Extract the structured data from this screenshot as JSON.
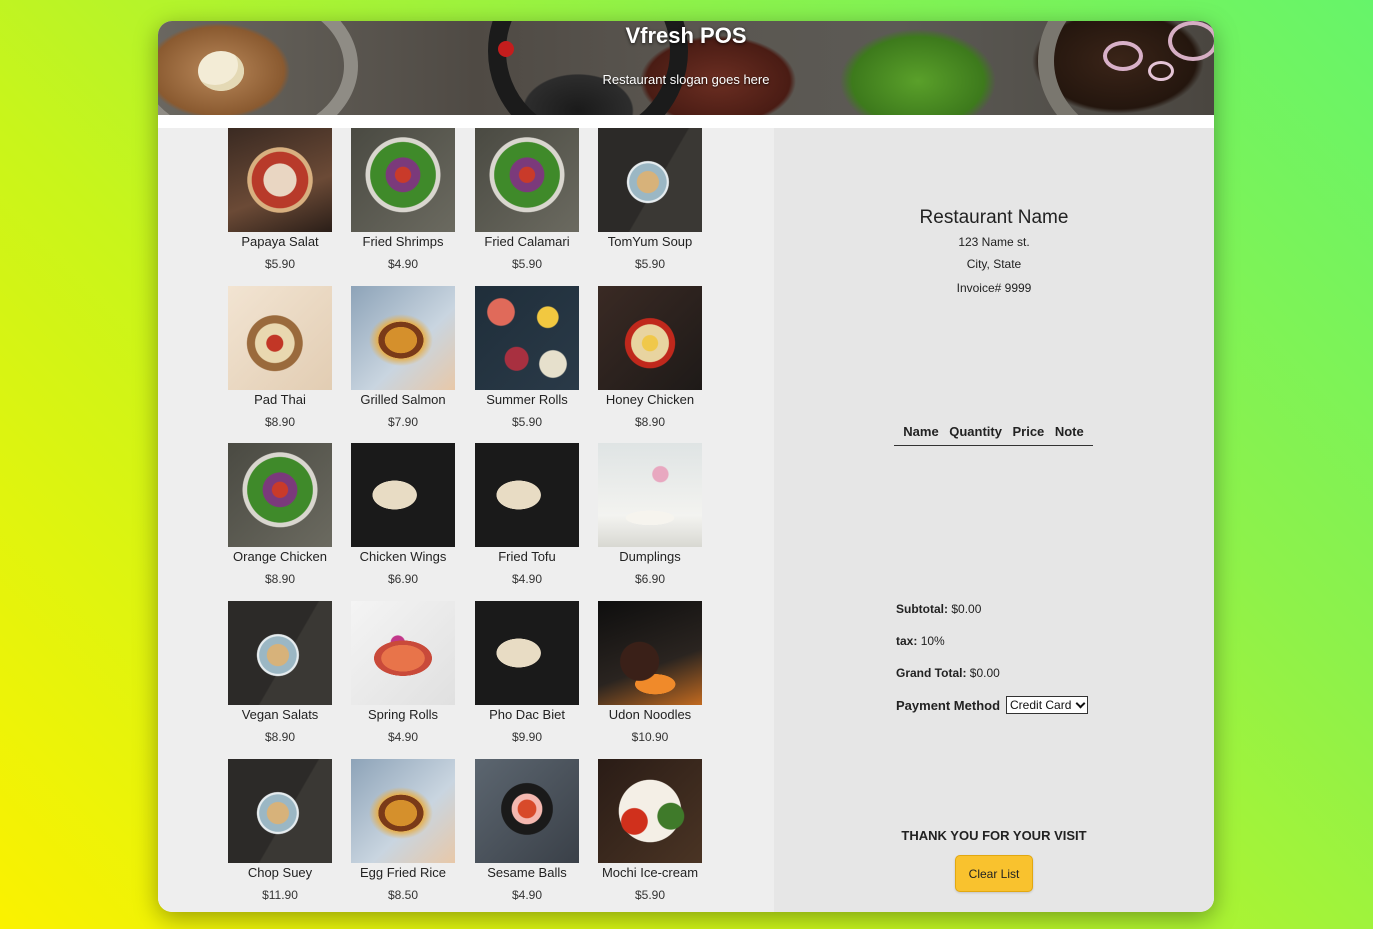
{
  "header": {
    "title": "Vfresh POS",
    "slogan": "Restaurant slogan goes here"
  },
  "menu": [
    {
      "name": "Papaya Salat",
      "price": "$5.90",
      "image": "pizza"
    },
    {
      "name": "Fried Shrimps",
      "price": "$4.90",
      "image": "salad"
    },
    {
      "name": "Fried Calamari",
      "price": "$5.90",
      "image": "salad"
    },
    {
      "name": "TomYum Soup",
      "price": "$5.90",
      "image": "soup"
    },
    {
      "name": "Pad Thai",
      "price": "$8.90",
      "image": "bowl"
    },
    {
      "name": "Grilled Salmon",
      "price": "$7.90",
      "image": "burger"
    },
    {
      "name": "Summer Rolls",
      "price": "$5.90",
      "image": "spread"
    },
    {
      "name": "Honey Chicken",
      "price": "$8.90",
      "image": "noodlebowl"
    },
    {
      "name": "Orange Chicken",
      "price": "$8.90",
      "image": "salad"
    },
    {
      "name": "Chicken Wings",
      "price": "$6.90",
      "image": "pho"
    },
    {
      "name": "Fried Tofu",
      "price": "$4.90",
      "image": "pho"
    },
    {
      "name": "Dumplings",
      "price": "$6.90",
      "image": "dumpling"
    },
    {
      "name": "Vegan Salats",
      "price": "$8.90",
      "image": "soup"
    },
    {
      "name": "Spring Rolls",
      "price": "$4.90",
      "image": "salmon"
    },
    {
      "name": "Pho Dac Biet",
      "price": "$9.90",
      "image": "pho"
    },
    {
      "name": "Udon Noodles",
      "price": "$10.90",
      "image": "steak"
    },
    {
      "name": "Chop Suey",
      "price": "$11.90",
      "image": "soup"
    },
    {
      "name": "Egg Fried Rice",
      "price": "$8.50",
      "image": "burger"
    },
    {
      "name": "Sesame Balls",
      "price": "$4.90",
      "image": "sesame"
    },
    {
      "name": "Mochi Ice-cream",
      "price": "$5.90",
      "image": "plate"
    }
  ],
  "receipt": {
    "restaurant_name": "Restaurant Name",
    "address": "123 Name st.",
    "city": "City, State",
    "invoice": "Invoice# 9999",
    "columns": [
      "Name",
      "Quantity",
      "Price",
      "Note"
    ],
    "subtotal_label": "Subtotal:",
    "subtotal_value": "$0.00",
    "tax_label": "tax:",
    "tax_value": "10%",
    "grand_total_label": "Grand Total:",
    "grand_total_value": "$0.00",
    "payment_label": "Payment Method",
    "payment_selected": "Credit Card",
    "thanks": "THANK YOU FOR YOUR VISIT",
    "clear_button": "Clear List"
  },
  "colors": {
    "accent_button": "#f9c22e",
    "menu_panel": "#eeeeee",
    "receipt_panel": "#e6e6e6"
  }
}
